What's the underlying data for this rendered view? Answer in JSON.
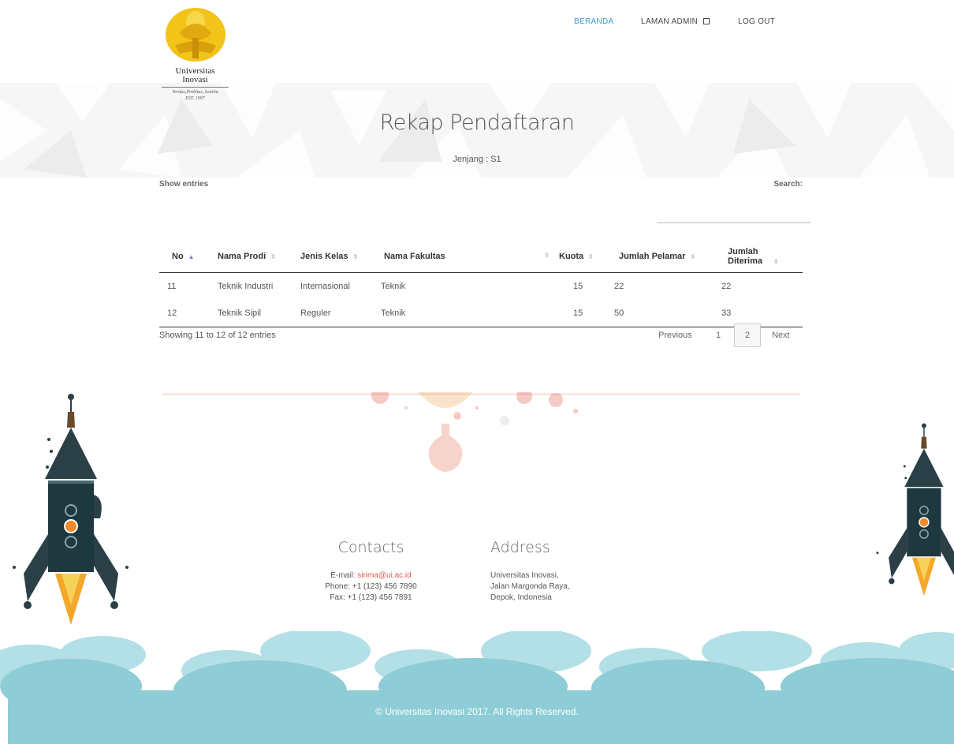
{
  "logo": {
    "name_line1": "Universitas",
    "name_line2": "Inovasi",
    "motto": "Veritas,Probitas, Iustitia",
    "est": "EST. 1997"
  },
  "nav": {
    "items": [
      {
        "label": "BERANDA",
        "active": true
      },
      {
        "label": "LAMAN ADMIN",
        "icon": "dropdown-square-icon"
      },
      {
        "label": "LOG OUT"
      }
    ]
  },
  "page": {
    "title": "Rekap Pendaftaran",
    "subtitle": "Jenjang : S1"
  },
  "table_controls": {
    "show_entries": "Show entries",
    "search_label": "Search:",
    "search_value": ""
  },
  "table": {
    "headers": [
      "No",
      "Nama Prodi",
      "Jenis Kelas",
      "Nama Fakultas",
      "Kuota",
      "Jumlah Pelamar",
      "Jumlah Diterima"
    ],
    "rows": [
      [
        "11",
        "Teknik Industri",
        "Internasional",
        "Teknik",
        "15",
        "22",
        "22"
      ],
      [
        "12",
        "Teknik Sipil",
        "Reguler",
        "Teknik",
        "15",
        "50",
        "33"
      ]
    ]
  },
  "pagination": {
    "info": "Showing 11 to 12 of 12 entries",
    "previous": "Previous",
    "page1": "1",
    "page2": "2",
    "next": "Next"
  },
  "footer": {
    "contacts_title": "Contacts",
    "email_label": "E-mail: ",
    "email": "sirima@ui.ac.id",
    "phone": "Phone: +1 (123) 456 7890",
    "fax": "Fax: +1 (123) 456 7891",
    "address_title": "Address",
    "address_lines": [
      "Universitas Inovasi,",
      "Jalan Margonda Raya,",
      "Depok, Indonesia"
    ],
    "copyright": "© Universitas Inovasi 2017. All Rights Reserved."
  },
  "colors": {
    "accent": "#3a9ad9",
    "email": "#e05a4e",
    "clouds": "#8ecdd6",
    "rocket": "#2a3f46",
    "flame": "#f4a72a"
  }
}
